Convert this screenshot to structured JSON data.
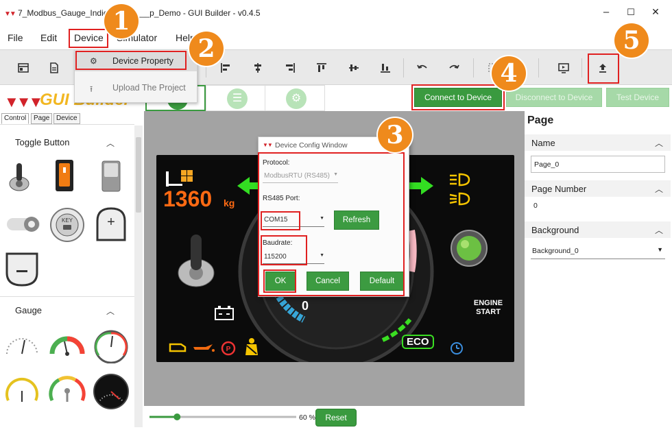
{
  "window": {
    "title": "7_Modbus_Gauge_Indicator_T____p_Demo - GUI Builder - v0.4.5",
    "minimize": "–",
    "maximize": "☐",
    "close": "✕"
  },
  "menu": {
    "file": "File",
    "edit": "Edit",
    "device": "Device",
    "simulator": "Simulator",
    "help": "Help"
  },
  "device_menu": {
    "items": [
      {
        "label": "Device Property",
        "icon": "gear-icon"
      },
      {
        "label": "Upload The Project",
        "icon": "upload-icon"
      }
    ]
  },
  "left_panel": {
    "brand": "GUI Builder",
    "tabs": [
      "Control",
      "Page",
      "Device"
    ],
    "sections": [
      "Toggle Button",
      "Gauge"
    ]
  },
  "device_buttons": {
    "connect": "Connect to Device",
    "disconnect": "Disconnect to Device",
    "test": "Test Device"
  },
  "dashboard": {
    "weight_value": "1360",
    "weight_unit": "kg",
    "gauge_value": "0",
    "engine_label": "ENGINE\nSTART",
    "eco_label": "ECO"
  },
  "dialog": {
    "title": "Device Config Window",
    "protocol_label": "Protocol:",
    "protocol_value": "ModbusRTU (RS485)",
    "port_label": "RS485 Port:",
    "port_value": "COM15",
    "refresh": "Refresh",
    "baudrate_label": "Baudrate:",
    "baudrate_value": "115200",
    "ok": "OK",
    "cancel": "Cancel",
    "default": "Default"
  },
  "properties": {
    "title": "Page",
    "name_label": "Name",
    "name_value": "Page_0",
    "page_number_label": "Page Number",
    "page_number_value": "0",
    "background_label": "Background",
    "background_value": "Background_0"
  },
  "zoom": {
    "label": "60 %",
    "value": 0.6,
    "reset": "Reset"
  },
  "steps": [
    "1",
    "2",
    "3",
    "4",
    "5"
  ],
  "colors": {
    "accent_green": "#3a9a3f",
    "highlight_red": "#e02020",
    "step_badge": "#ef8a1c"
  }
}
